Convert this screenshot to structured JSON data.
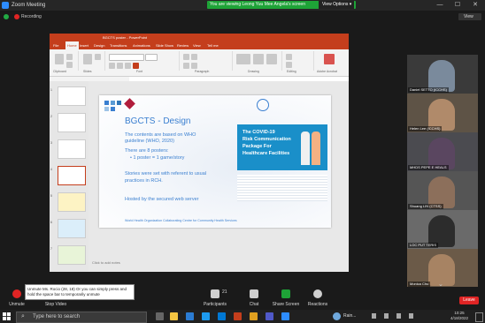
{
  "window": {
    "title": "Zoom Meeting",
    "share_banner": "You are viewing Leong Yuu Mee Angela's screen",
    "view_options": "View Options ▾",
    "min": "—",
    "max": "☐",
    "close": "✕"
  },
  "top_bar": {
    "recording_label": "Recording",
    "view_label": "View"
  },
  "powerpoint": {
    "title": "BGCTS poster - PowerPoint",
    "tabs": [
      "File",
      "Home",
      "Insert",
      "Design",
      "Transitions",
      "Animations",
      "Slide Show",
      "Review",
      "View",
      "Tell me"
    ],
    "active_tab": "Home",
    "ribbon_groups": [
      "Clipboard",
      "Slides",
      "Font",
      "Paragraph",
      "Drawing",
      "Editing",
      "Adobe Acrobat"
    ],
    "notes_placeholder": "Click to add notes",
    "slide_numbers": [
      "1",
      "2",
      "3",
      "4",
      "5",
      "6",
      "7"
    ]
  },
  "slide": {
    "heading": "BGCTS - Design",
    "bullets": [
      "The contents are based on WHO",
      "guideline (WHO, 2020)",
      "There are 8 posters:",
      "• 1 poster = 1 game/story",
      "Stories were set with referent to usual",
      "practices in RCH.",
      "Hosted by the secured web server"
    ],
    "poster_lines": [
      "The COVID-19",
      "Risk Communication",
      "Package For",
      "Healthcare Facilities"
    ],
    "footer": "World Health Organization Collaborating Centre for Community Health Services"
  },
  "participants": [
    {
      "name": "Daniel SETTO (ICCHS)"
    },
    {
      "name": "Helen Lee (ICCHS)"
    },
    {
      "name": "MHDS PEPE E HEALS"
    },
    {
      "name": "Shuang LIN (CTSS)"
    },
    {
      "name": "LOC PUT TERIS"
    },
    {
      "name": "Monica Chu"
    }
  ],
  "caption": {
    "line1": "Unmute Ms. Rocio (28, 18) Or you can simply press and",
    "line2": "hold the space bar to temporarily unmute"
  },
  "toolbar": {
    "buttons": [
      "Unmute",
      "Stop Video",
      "Participants",
      "Chat",
      "Share Screen",
      "Reactions"
    ],
    "participant_count": "21",
    "leave": "Leave"
  },
  "taskbar": {
    "search_placeholder": "Type here to search",
    "weather": "Rain...",
    "time": "10:25",
    "date": "4/18/2022"
  },
  "colors": {
    "ppt_red": "#c43e1c",
    "zoom_green": "#1ea337",
    "leave_red": "#e02424",
    "slide_blue": "#3a7fd0"
  }
}
